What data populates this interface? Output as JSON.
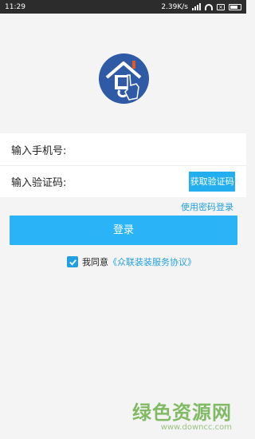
{
  "status_bar": {
    "time": "11:29",
    "network_speed": "2.39K/s",
    "icons": [
      "signal-icon",
      "wifi-icon",
      "notification-icon",
      "battery-icon"
    ]
  },
  "logo": {
    "description_name": "app-logo-house-hand"
  },
  "form": {
    "phone_label": "输入手机号:",
    "phone_value": "",
    "code_label": "输入验证码:",
    "code_value": "",
    "get_code_button": "获取验证码"
  },
  "password_login_link": "使用密码登录",
  "login_button": "登录",
  "agreement": {
    "checked": true,
    "prefix": "我同意",
    "link": "《众联装装服务协议》"
  },
  "watermark": {
    "main": "绿色资源网",
    "sub": "www.downcc.com"
  },
  "colors": {
    "accent": "#2ab4f7",
    "link": "#22a0de",
    "status_bar": "#2c2c2c",
    "background": "#f4f4f4",
    "logo_blue": "#2f5aa6"
  }
}
